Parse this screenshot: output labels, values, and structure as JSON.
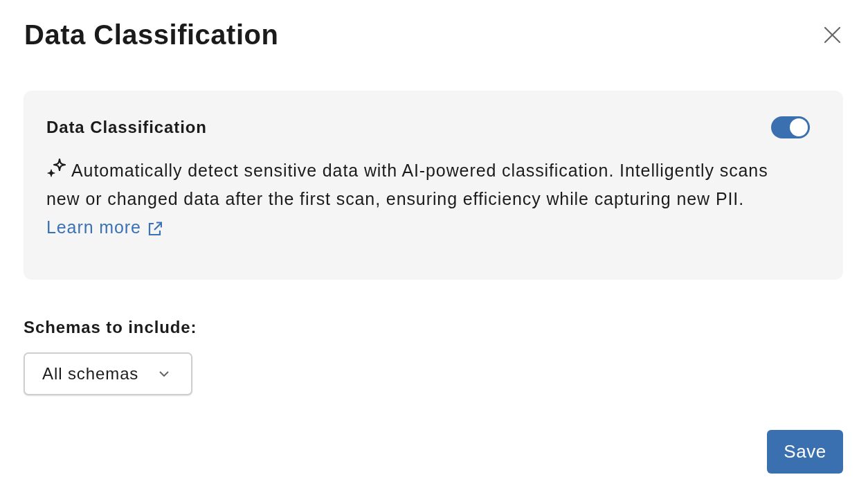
{
  "dialog": {
    "title": "Data Classification"
  },
  "card": {
    "title": "Data Classification",
    "enabled": true,
    "description": "Automatically detect sensitive data with AI-powered classification. Intelligently scans new or changed data after the first scan, ensuring efficiency while capturing new PII.",
    "link": "Learn more"
  },
  "schemas": {
    "label": "Schemas to include:",
    "value": "All schemas"
  },
  "buttons": [
    {
      "label": "Save",
      "kind": "primary"
    }
  ]
}
